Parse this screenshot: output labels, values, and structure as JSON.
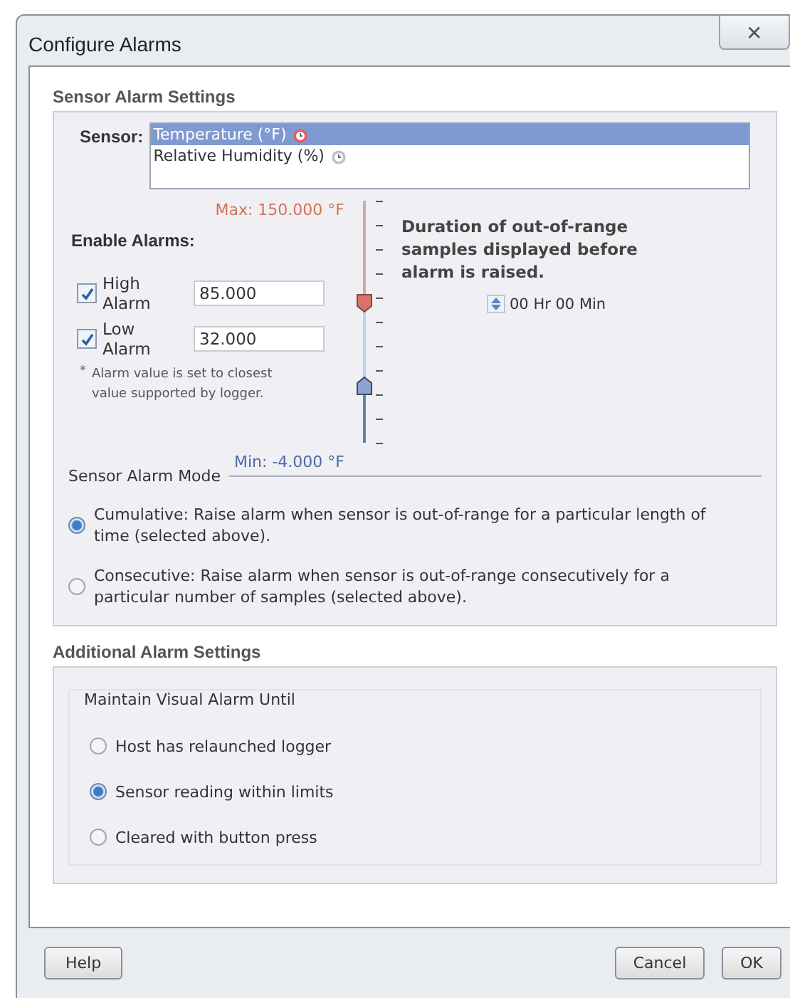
{
  "window": {
    "title": "Configure Alarms",
    "close": "✕"
  },
  "sensor_alarm_settings": {
    "heading": "Sensor Alarm Settings",
    "sensor_label": "Sensor:",
    "sensors": [
      {
        "name": "Temperature (°F)",
        "selected": true,
        "alarm_on": true
      },
      {
        "name": "Relative Humidity (%)",
        "selected": false,
        "alarm_on": false
      }
    ],
    "enable_heading": "Enable Alarms:",
    "max_label": "Max: 150.000 °F",
    "min_label": "Min: -4.000 °F",
    "alarms": [
      {
        "label": "High Alarm",
        "checked": true,
        "value": "85.000",
        "level": 0.578,
        "kind": "high"
      },
      {
        "label": "Low Alarm",
        "checked": true,
        "value": "32.000",
        "level": 0.234,
        "kind": "low"
      }
    ],
    "note_mark": "*",
    "note": "Alarm value is set to closest value supported by logger.",
    "duration_text": "Duration of out-of-range samples displayed before alarm is raised.",
    "duration_value": "00 Hr 00 Min",
    "mode_heading": "Sensor Alarm Mode",
    "modes": [
      {
        "label": "Cumulative: Raise alarm when sensor is out-of-range for a particular length of time (selected above).",
        "selected": true
      },
      {
        "label": "Consecutive: Raise alarm when sensor is out-of-range consecutively for a particular number of samples (selected above).",
        "selected": false
      }
    ]
  },
  "additional_alarm_settings": {
    "heading": "Additional Alarm Settings",
    "group_label": "Maintain Visual Alarm Until",
    "options": [
      {
        "label": "Host has relaunched logger",
        "selected": false
      },
      {
        "label": "Sensor reading within limits",
        "selected": true
      },
      {
        "label": "Cleared with button press",
        "selected": false
      }
    ]
  },
  "buttons": {
    "help": "Help",
    "cancel": "Cancel",
    "ok": "OK"
  }
}
